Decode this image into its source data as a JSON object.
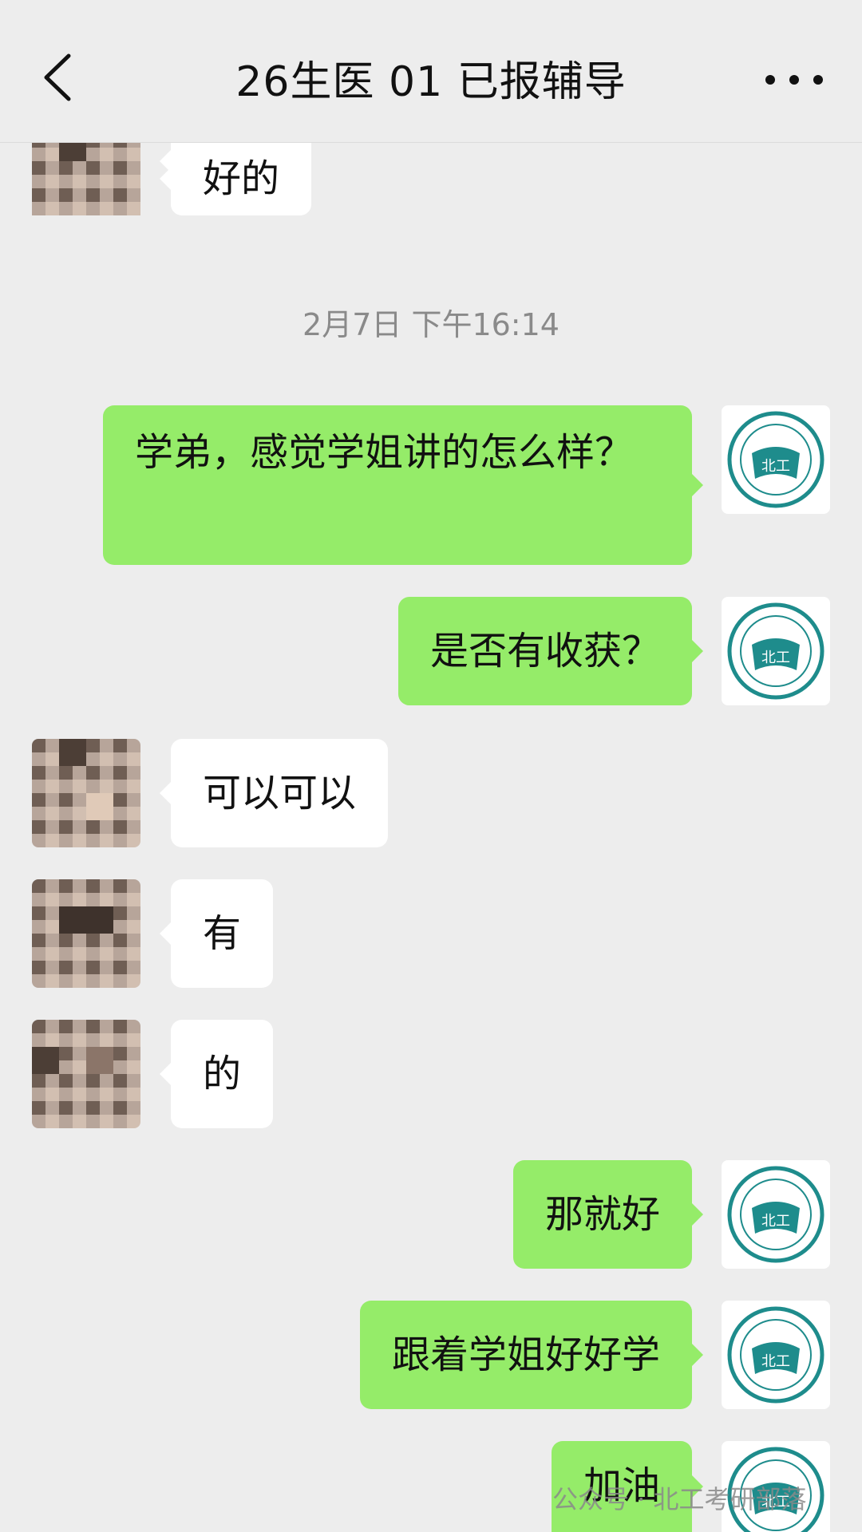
{
  "header": {
    "title": "26生医 01 已报辅导",
    "back_icon": "chevron-left-icon",
    "more_icon": "ellipsis-icon"
  },
  "timestamp": "2月7日 下午16:14",
  "messages": [
    {
      "side": "in",
      "text": "好的"
    },
    {
      "side": "out",
      "text": "学弟，感觉学姐讲的怎么样？"
    },
    {
      "side": "out",
      "text": "是否有收获？"
    },
    {
      "side": "in",
      "text": "可以可以"
    },
    {
      "side": "in",
      "text": "有"
    },
    {
      "side": "in",
      "text": "的"
    },
    {
      "side": "out",
      "text": "那就好"
    },
    {
      "side": "out",
      "text": "跟着学姐好好学"
    },
    {
      "side": "out",
      "text": "加油"
    }
  ],
  "avatar_logo_text": "北工",
  "watermark": "公众号 · 北工考研部落",
  "colors": {
    "background": "#ededed",
    "outgoing_bubble": "#95ec69",
    "incoming_bubble": "#ffffff",
    "logo_teal": "#1e8c8c"
  }
}
